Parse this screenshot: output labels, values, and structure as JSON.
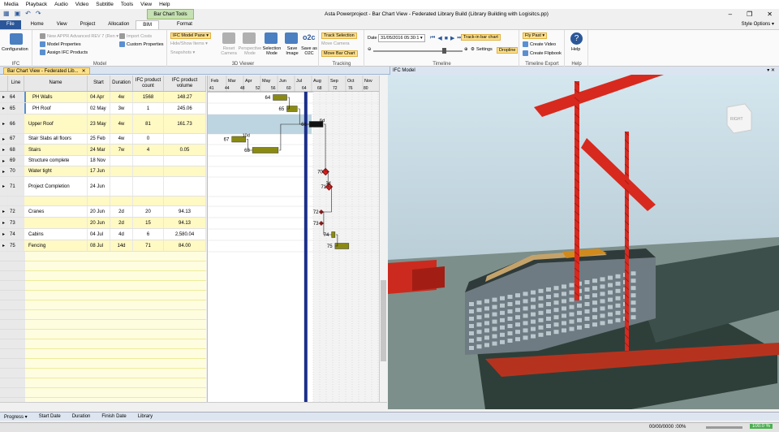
{
  "menu": [
    "Media",
    "Playback",
    "Audio",
    "Video",
    "Subtitle",
    "Tools",
    "View",
    "Help"
  ],
  "window_title": "Asta Powerproject - Bar Chart View - Federated Library Build (Library Building with Logisitcs.pp)",
  "window_controls": {
    "minimize": "–",
    "restore": "❐",
    "close": "✕"
  },
  "context_tab": "Bar Chart Tools",
  "tabs": [
    "File",
    "Home",
    "View",
    "Project",
    "Allocation",
    "BIM",
    "Format"
  ],
  "active_tab": "BIM",
  "style_options": "Style Options ▾",
  "ribbon": {
    "ifc": {
      "configuration": "Configuration",
      "label": "IFC"
    },
    "model": {
      "new_appr": "New APPR Advanced REV 7 (Ren ▾",
      "model_properties": "Model Properties",
      "assign_ifc": "Assign IFC Products",
      "import_costs": "Import Costs",
      "custom_properties": "Custom Properties",
      "label": "Model"
    },
    "viewer": {
      "ifc_model_pane": "IFC Model Pane ▾",
      "hide_show": "Hide/Show Items ▾",
      "snapshots": "Snapshots ▾",
      "reset_camera": "Reset Camera",
      "perspective": "Perspective Mode",
      "selection": "Selection Mode",
      "save_image": "Save Image",
      "save_o2c": "Save as O2C",
      "o2c": "o2c",
      "label": "3D Viewer"
    },
    "tracking": {
      "track_selection": "Track Selection",
      "move_camera": "Move Camera",
      "move_bar_chart": "Move Bar Chart",
      "label": "Tracking"
    },
    "timeline": {
      "date_label": "Date",
      "date_value": "31/05/2016 05:30:1 ▾",
      "track_in_bar": "Track-in bar chart",
      "settings": "Settings",
      "dropline": "Dropline",
      "label": "Timeline"
    },
    "export": {
      "fly_past": "Fly Past ▾",
      "create_video": "Create Video",
      "create_flipbook": "Create Flipbook",
      "label": "Timeline Export"
    },
    "help": {
      "help": "Help",
      "label": "Help"
    }
  },
  "doc_tab": "Bar Chart View - Federated Lib...",
  "doc_tab_close": "✕",
  "ifc_pane_title": "IFC Model",
  "ifc_pane_controls": "▾ ✕",
  "view_cube_label": "RIGHT",
  "columns": [
    "Line",
    "Name",
    "Start",
    "Duration",
    "IFC product count",
    "IFC product volume"
  ],
  "months": [
    "Feb",
    "Mar",
    "Apr",
    "May",
    "Jun",
    "Jul",
    "Aug",
    "Sep",
    "Oct",
    "Nov"
  ],
  "weeks": [
    "41",
    "44",
    "48",
    "52",
    "56",
    "60",
    "64",
    "68",
    "72",
    "76",
    "80"
  ],
  "rows": [
    {
      "line": "64",
      "name": "PH Walls",
      "start": "04 Apr",
      "dur": "4w",
      "count": "1568",
      "vol": "148.27",
      "h": 14,
      "yellow": true,
      "indent": true
    },
    {
      "line": "65",
      "name": "PH Roof",
      "start": "02 May",
      "dur": "3w",
      "count": "1",
      "vol": "245.06",
      "h": 14,
      "yellow": false,
      "indent": true
    },
    {
      "line": "66",
      "name": "Upper Roof",
      "start": "23 May",
      "dur": "4w",
      "count": "81",
      "vol": "161.73",
      "h": 24,
      "yellow": true,
      "indent": false
    },
    {
      "line": "67",
      "name": "Stair Slabs all floors",
      "start": "25 Feb",
      "dur": "4w",
      "count": "0",
      "vol": "",
      "h": 13,
      "yellow": false,
      "indent": false
    },
    {
      "line": "68",
      "name": "Stairs",
      "start": "24 Mar",
      "dur": "7w",
      "count": "4",
      "vol": "0.05",
      "h": 14,
      "yellow": true,
      "indent": false
    },
    {
      "line": "69",
      "name": "Structure complete",
      "start": "18 Nov",
      "dur": "",
      "count": "",
      "vol": "",
      "h": 13,
      "yellow": false,
      "indent": false
    },
    {
      "line": "70",
      "name": "Water tight",
      "start": "17 Jun",
      "dur": "",
      "count": "",
      "vol": "",
      "h": 13,
      "yellow": true,
      "indent": false
    },
    {
      "line": "71",
      "name": "Project Completion",
      "start": "24 Jun",
      "dur": "",
      "count": "",
      "vol": "",
      "h": 24,
      "yellow": false,
      "indent": false
    },
    {
      "line": "",
      "name": "",
      "start": "",
      "dur": "",
      "count": "",
      "vol": "",
      "h": 12,
      "yellow": true,
      "indent": false
    },
    {
      "line": "72",
      "name": "Cranes",
      "start": "20 Jun",
      "dur": "2d",
      "count": "20",
      "vol": "94.13",
      "h": 14,
      "yellow": false,
      "indent": false
    },
    {
      "line": "73",
      "name": "",
      "start": "20 Jun",
      "dur": "2d",
      "count": "15",
      "vol": "94.13",
      "h": 14,
      "yellow": true,
      "indent": false
    },
    {
      "line": "74",
      "name": "Cabins",
      "start": "04 Jul",
      "dur": "4d",
      "count": "6",
      "vol": "2,580.04",
      "h": 14,
      "yellow": false,
      "indent": false
    },
    {
      "line": "75",
      "name": "Fencing",
      "start": "08 Jul",
      "dur": "14d",
      "count": "71",
      "vol": "84.00",
      "h": 14,
      "yellow": true,
      "indent": false
    }
  ],
  "bars": [
    {
      "id": "64",
      "start": 0.38,
      "end": 0.46,
      "row": 0,
      "color": "#8a8a12"
    },
    {
      "id": "65",
      "start": 0.46,
      "end": 0.52,
      "row": 1,
      "color": "#8a8a12"
    },
    {
      "id": "66",
      "start": 0.59,
      "end": 0.67,
      "row": 2,
      "color": "#111111",
      "label": "6d"
    },
    {
      "id": "67",
      "start": 0.14,
      "end": 0.22,
      "row": 3,
      "color": "#8a8a12",
      "label": "10d"
    },
    {
      "id": "68",
      "start": 0.26,
      "end": 0.41,
      "row": 4,
      "color": "#8a8a12"
    },
    {
      "id": "70",
      "milestone": 0.685,
      "row": 6
    },
    {
      "id": "71",
      "milestone": 0.705,
      "row": 7,
      "label": "1d"
    },
    {
      "id": "72",
      "milestone": 0.66,
      "row": 9,
      "tiny": true
    },
    {
      "id": "73",
      "milestone": 0.66,
      "row": 10,
      "tiny": true
    },
    {
      "id": "74",
      "start": 0.72,
      "end": 0.74,
      "row": 11,
      "color": "#8a8a12"
    },
    {
      "id": "75",
      "start": 0.74,
      "end": 0.82,
      "row": 12,
      "color": "#8a8a12"
    }
  ],
  "today_line": 0.57,
  "filterbar": [
    "Progress ▾",
    "Start Date",
    "Duration",
    "Finish Date",
    "Library"
  ],
  "status": {
    "time": "00/00/0000 :00%",
    "zoom": "100.0 %"
  },
  "colors": {
    "accent": "#2b579a",
    "crane": "#d8291e",
    "yellow_row": "#fff9c4",
    "bar": "#8a8a12"
  }
}
